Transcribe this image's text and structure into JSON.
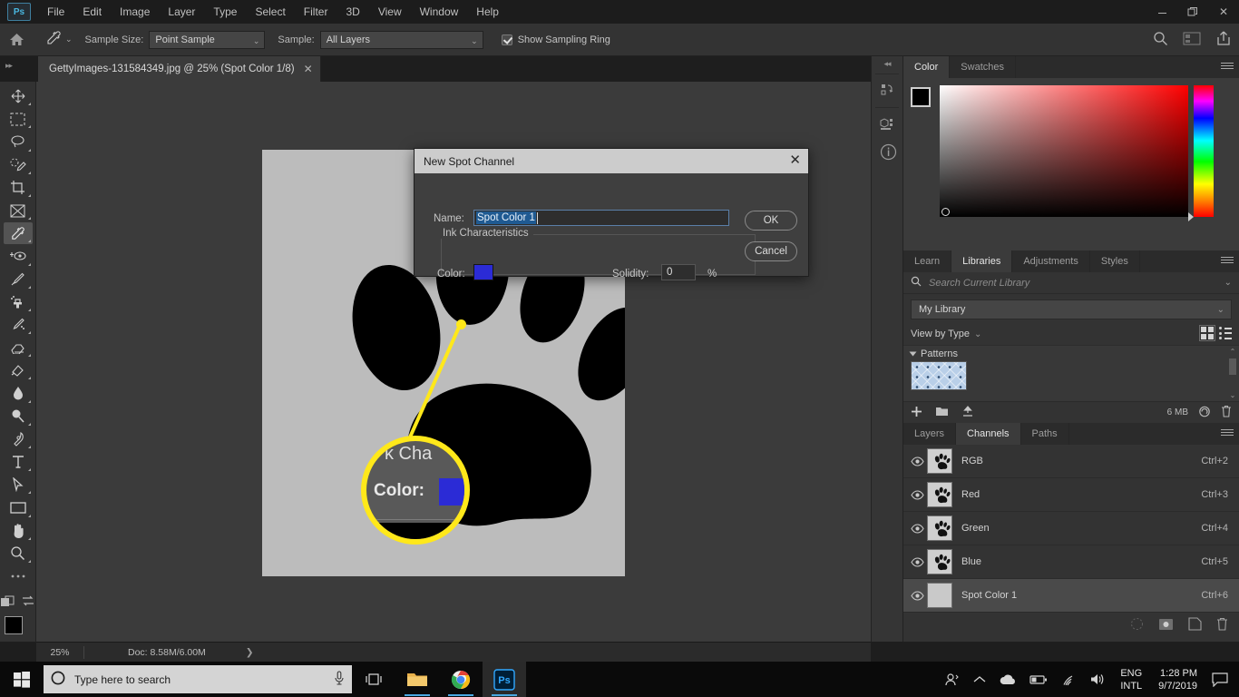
{
  "window": {
    "app_logo": "Ps",
    "minimize": "—",
    "restore": "restore-icon",
    "close": "✕"
  },
  "menubar": {
    "items": [
      "File",
      "Edit",
      "Image",
      "Layer",
      "Type",
      "Select",
      "Filter",
      "3D",
      "View",
      "Window",
      "Help"
    ]
  },
  "optionsbar": {
    "home_icon": "home-icon",
    "tool_icon": "eyedropper-icon",
    "sample_size_label": "Sample Size:",
    "sample_size_value": "Point Sample",
    "sample_label": "Sample:",
    "sample_value": "All Layers",
    "show_sampling_ring_label": "Show Sampling Ring",
    "show_sampling_ring_checked": true,
    "right_icons": [
      "search-icon",
      "workspace-icon",
      "share-icon"
    ]
  },
  "tabbar": {
    "document_title": "GettyImages-131584349.jpg @ 25% (Spot Color 1/8)",
    "close_glyph": "✕",
    "left_arrows": "▸▸",
    "right_arrows": "▸▸"
  },
  "toolbar": {
    "tools": [
      {
        "name": "move-tool"
      },
      {
        "name": "rectangular-marquee-tool"
      },
      {
        "name": "lasso-tool"
      },
      {
        "name": "quick-selection-tool"
      },
      {
        "name": "crop-tool"
      },
      {
        "name": "frame-tool"
      },
      {
        "name": "eyedropper-tool",
        "active": true
      },
      {
        "name": "spot-healing-brush-tool"
      },
      {
        "name": "brush-tool"
      },
      {
        "name": "clone-stamp-tool"
      },
      {
        "name": "history-brush-tool"
      },
      {
        "name": "eraser-tool"
      },
      {
        "name": "gradient-tool"
      },
      {
        "name": "blur-tool"
      },
      {
        "name": "dodge-tool"
      },
      {
        "name": "pen-tool"
      },
      {
        "name": "type-tool"
      },
      {
        "name": "path-selection-tool"
      },
      {
        "name": "rectangle-tool"
      },
      {
        "name": "hand-tool"
      },
      {
        "name": "zoom-tool"
      },
      {
        "name": "more-tools"
      }
    ],
    "foreground_color": "#000000",
    "background_color": "#c8c8c8"
  },
  "statusbar": {
    "zoom": "25%",
    "doc_info": "Doc: 8.58M/6.00M",
    "arrow": "❯"
  },
  "rail": {
    "collapse": "◂◂",
    "buttons": [
      "history-icon",
      "3d-icon",
      "info-icon"
    ]
  },
  "color_panel": {
    "tabs": [
      {
        "label": "Color",
        "active": true
      },
      {
        "label": "Swatches",
        "active": false
      }
    ],
    "foreground_color": "#000000",
    "background_color": "#c9c9c9",
    "menu_icon": "panel-menu-icon"
  },
  "libraries_panel": {
    "tabs": [
      {
        "label": "Learn",
        "active": false
      },
      {
        "label": "Libraries",
        "active": true
      },
      {
        "label": "Adjustments",
        "active": false
      },
      {
        "label": "Styles",
        "active": false
      }
    ],
    "search_placeholder": "Search Current Library",
    "search_value": "",
    "search_icon": "search-icon",
    "library_select": "My Library",
    "view_by": "View by Type",
    "grid_view_icon": "grid-view-icon",
    "list_view_icon": "list-view-icon",
    "group_name": "Patterns",
    "memory": "6 MB",
    "footer_icons": [
      "add-icon",
      "new-group-icon",
      "upload-icon",
      "cloud-icon",
      "delete-icon"
    ],
    "menu_icon": "panel-menu-icon"
  },
  "channels_panel": {
    "tabs": [
      {
        "label": "Layers",
        "active": false
      },
      {
        "label": "Channels",
        "active": true
      },
      {
        "label": "Paths",
        "active": false
      }
    ],
    "menu_icon": "panel-menu-icon",
    "rows": [
      {
        "name": "RGB",
        "shortcut": "Ctrl+2",
        "visible": true,
        "selected": false,
        "thumb": "paw"
      },
      {
        "name": "Red",
        "shortcut": "Ctrl+3",
        "visible": true,
        "selected": false,
        "thumb": "paw"
      },
      {
        "name": "Green",
        "shortcut": "Ctrl+4",
        "visible": true,
        "selected": false,
        "thumb": "paw"
      },
      {
        "name": "Blue",
        "shortcut": "Ctrl+5",
        "visible": true,
        "selected": false,
        "thumb": "paw"
      },
      {
        "name": "Spot Color 1",
        "shortcut": "Ctrl+6",
        "visible": true,
        "selected": true,
        "thumb": "blank"
      }
    ],
    "footer_icons": [
      "load-selection-icon",
      "save-selection-icon",
      "new-channel-icon",
      "delete-channel-icon"
    ]
  },
  "dialog": {
    "title": "New Spot Channel",
    "close_glyph": "✕",
    "name_label": "Name:",
    "name_value": "Spot Color 1",
    "fieldset_legend": "Ink Characteristics",
    "color_label": "Color:",
    "color_value": "#2b2bd6",
    "solidity_label": "Solidity:",
    "solidity_value": "0",
    "percent_symbol": "%",
    "ok_label": "OK",
    "cancel_label": "Cancel"
  },
  "callout": {
    "partial_text": "k Cha",
    "label": "Color:",
    "chip_color": "#2b2bd6",
    "ring_color": "#ffe81a"
  },
  "taskbar": {
    "start_icon": "windows-start-icon",
    "search_placeholder": "Type here to search",
    "cortana_icon": "cortana-circle-icon",
    "mic_icon": "microphone-icon",
    "taskview_icon": "task-view-icon",
    "apps": [
      "file-explorer-icon",
      "chrome-icon",
      "photoshop-icon"
    ],
    "tray_people_icon": "people-icon",
    "tray_chevron": "chevron-up-icon",
    "tray_onedrive_icon": "onedrive-cloud-icon",
    "tray_battery_icon": "battery-icon",
    "tray_wifi_icon": "wifi-icon",
    "tray_volume_icon": "volume-icon",
    "lang_line1": "ENG",
    "lang_line2": "INTL",
    "time": "1:28 PM",
    "date": "9/7/2019",
    "action_center_icon": "action-center-icon"
  }
}
